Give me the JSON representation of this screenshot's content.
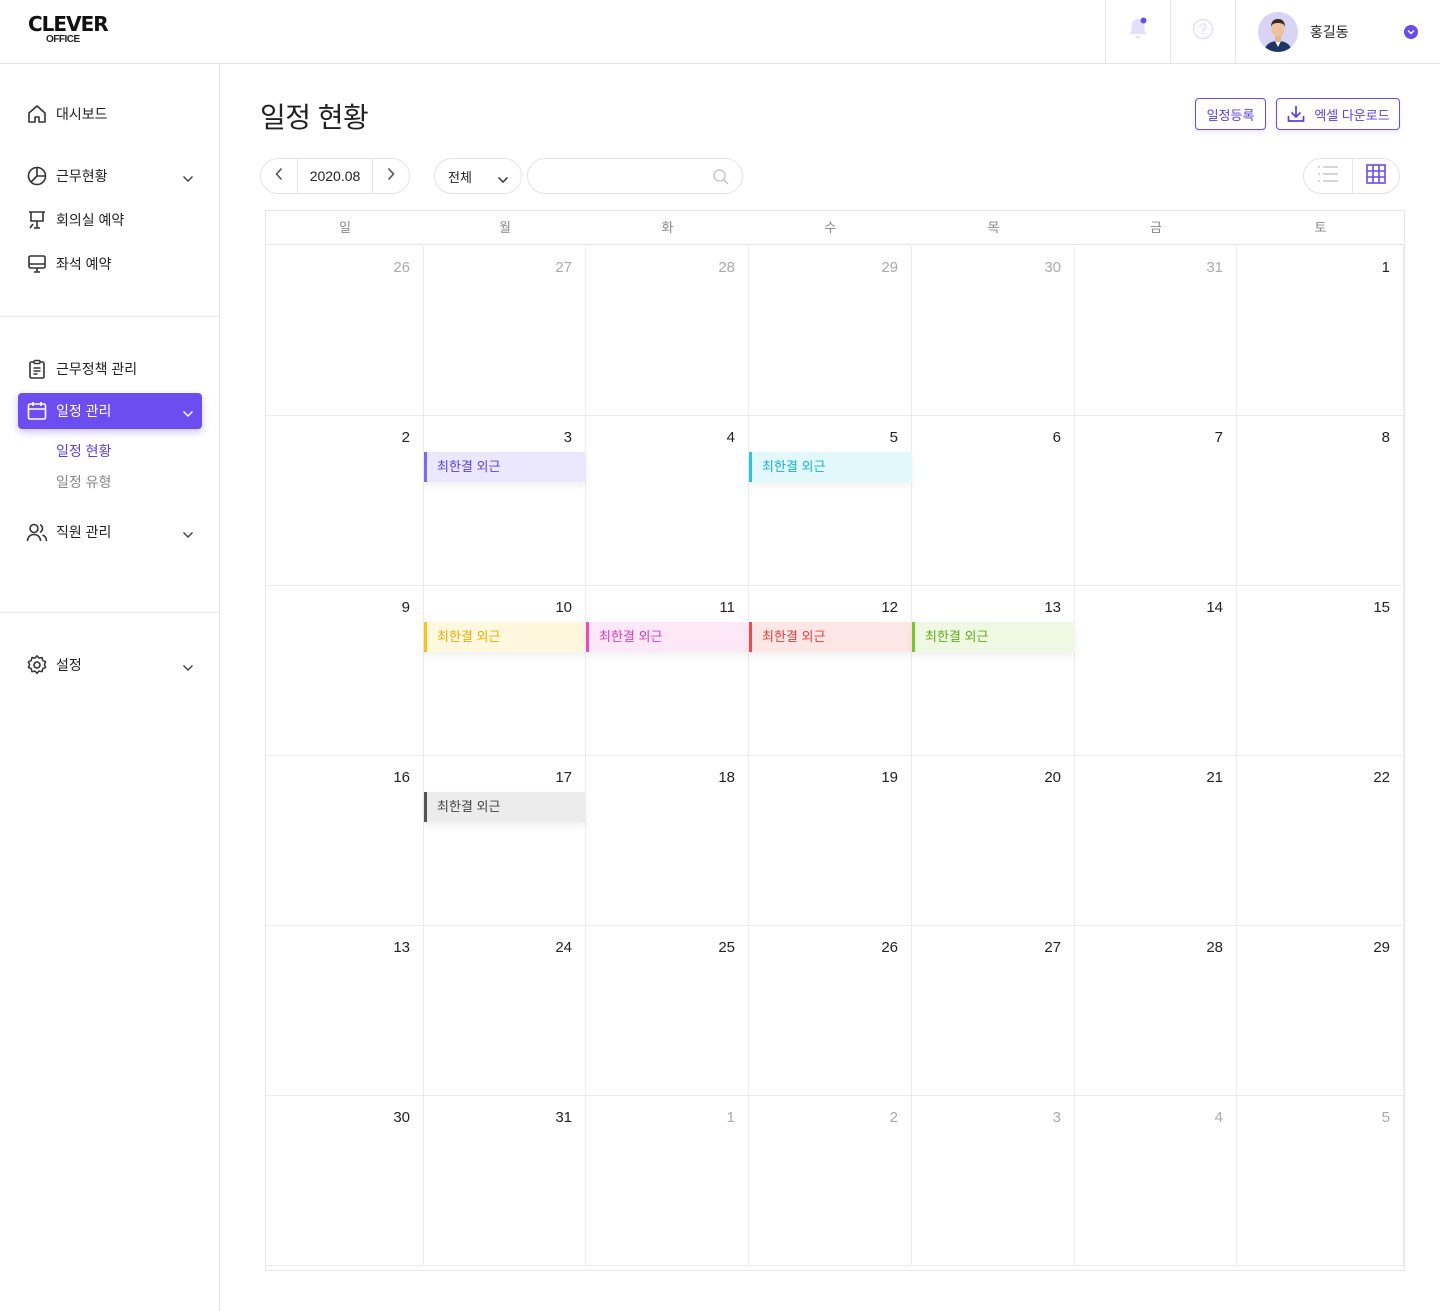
{
  "logo": {
    "line1": "CLEVER",
    "line2": "OFFICE"
  },
  "header": {
    "user_name": "홍길동"
  },
  "sidebar": {
    "group1": [
      {
        "key": "dashboard",
        "label": "대시보드",
        "icon": "home-icon",
        "chevron": false
      },
      {
        "key": "attendance",
        "label": "근무현황",
        "icon": "pie-chart-icon",
        "chevron": true
      },
      {
        "key": "meeting",
        "label": "회의실 예약",
        "icon": "presentation-board-icon",
        "chevron": false
      },
      {
        "key": "seat",
        "label": "좌석 예약",
        "icon": "monitor-icon",
        "chevron": false
      }
    ],
    "group2": [
      {
        "key": "policy",
        "label": "근무정책 관리",
        "icon": "clipboard-icon",
        "chevron": false
      },
      {
        "key": "schedule",
        "label": "일정 관리",
        "icon": "calendar-icon",
        "chevron": true,
        "active": true
      }
    ],
    "schedule_sub": [
      {
        "label": "일정 현황",
        "active": true
      },
      {
        "label": "일정 유형",
        "active": false
      }
    ],
    "employees": {
      "label": "직원 관리",
      "icon": "users-icon"
    },
    "settings": {
      "label": "설정",
      "icon": "gear-icon"
    }
  },
  "page": {
    "title": "일정 현황",
    "register_button": "일정등록",
    "excel_button": "엑셀 다운로드",
    "month": "2020.08",
    "filter_value": "전체",
    "search_placeholder": ""
  },
  "colors": {
    "accent": "#6c4ef0"
  },
  "calendar": {
    "weekdays": [
      "일",
      "월",
      "화",
      "수",
      "목",
      "금",
      "토"
    ],
    "weeks": [
      [
        {
          "d": "26",
          "m": true
        },
        {
          "d": "27",
          "m": true
        },
        {
          "d": "28",
          "m": true
        },
        {
          "d": "29",
          "m": true
        },
        {
          "d": "30",
          "m": true
        },
        {
          "d": "31",
          "m": true
        },
        {
          "d": "1"
        }
      ],
      [
        {
          "d": "2"
        },
        {
          "d": "3",
          "ev": {
            "label": "최한결 외근",
            "color": "#7b6be6",
            "bg": "#ebe7fd",
            "text": "#5b3fe0"
          }
        },
        {
          "d": "4"
        },
        {
          "d": "5",
          "ev": {
            "label": "최한결 외근",
            "color": "#2ec4d6",
            "bg": "#e3f8fb",
            "text": "#19b3c6"
          }
        },
        {
          "d": "6"
        },
        {
          "d": "7"
        },
        {
          "d": "8"
        }
      ],
      [
        {
          "d": "9"
        },
        {
          "d": "10",
          "ev": {
            "label": "최한결 외근",
            "color": "#f5c518",
            "bg": "#fff8df",
            "text": "#e0b000"
          }
        },
        {
          "d": "11",
          "ev": {
            "label": "최한결 외근",
            "color": "#e64bc6",
            "bg": "#fde8f8",
            "text": "#d63db7"
          }
        },
        {
          "d": "12",
          "ev": {
            "label": "최한결 외근",
            "color": "#e84c4c",
            "bg": "#fde6e6",
            "text": "#d94040"
          }
        },
        {
          "d": "13",
          "ev": {
            "label": "최한결 외근",
            "color": "#7bc52a",
            "bg": "#eef8e2",
            "text": "#62aa1c"
          }
        },
        {
          "d": "14"
        },
        {
          "d": "15"
        }
      ],
      [
        {
          "d": "16"
        },
        {
          "d": "17",
          "ev": {
            "label": "최한결 외근",
            "color": "#555555",
            "bg": "#ececec",
            "text": "#444444"
          }
        },
        {
          "d": "18"
        },
        {
          "d": "19"
        },
        {
          "d": "20"
        },
        {
          "d": "21"
        },
        {
          "d": "22"
        }
      ],
      [
        {
          "d": "13"
        },
        {
          "d": "24"
        },
        {
          "d": "25"
        },
        {
          "d": "26"
        },
        {
          "d": "27"
        },
        {
          "d": "28"
        },
        {
          "d": "29"
        }
      ],
      [
        {
          "d": "30"
        },
        {
          "d": "31"
        },
        {
          "d": "1",
          "m": true
        },
        {
          "d": "2",
          "m": true
        },
        {
          "d": "3",
          "m": true
        },
        {
          "d": "4",
          "m": true
        },
        {
          "d": "5",
          "m": true
        }
      ]
    ]
  }
}
